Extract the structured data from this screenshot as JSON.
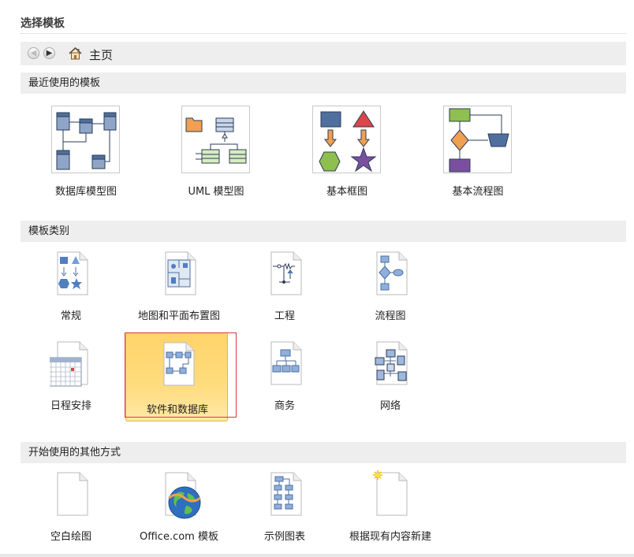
{
  "page": {
    "title": "选择模板"
  },
  "nav": {
    "back_icon": "arrow-left-icon",
    "forward_icon": "arrow-right-icon",
    "home_icon": "home-icon",
    "breadcrumb": "主页"
  },
  "recent": {
    "header": "最近使用的模板",
    "items": [
      {
        "label": "数据库模型图",
        "icon": "database-model-diagram-thumbnail"
      },
      {
        "label": "UML 模型图",
        "icon": "uml-model-diagram-thumbnail"
      },
      {
        "label": "基本框图",
        "icon": "basic-block-diagram-thumbnail"
      },
      {
        "label": "基本流程图",
        "icon": "basic-flowchart-thumbnail"
      }
    ]
  },
  "categories": {
    "header": "模板类别",
    "items": [
      {
        "label": "常规",
        "icon": "general-template-icon"
      },
      {
        "label": "地图和平面布置图",
        "icon": "maps-floor-plans-icon"
      },
      {
        "label": "工程",
        "icon": "engineering-icon"
      },
      {
        "label": "流程图",
        "icon": "flowchart-icon"
      },
      {
        "label": "日程安排",
        "icon": "schedule-icon"
      },
      {
        "label": "软件和数据库",
        "icon": "software-database-icon",
        "selected": true
      },
      {
        "label": "商务",
        "icon": "business-icon"
      },
      {
        "label": "网络",
        "icon": "network-icon"
      }
    ]
  },
  "other": {
    "header": "开始使用的其他方式",
    "items": [
      {
        "label": "空白绘图",
        "icon": "blank-drawing-icon"
      },
      {
        "label": "Office.com 模板",
        "icon": "office-com-globe-icon"
      },
      {
        "label": "示例图表",
        "icon": "sample-diagram-icon"
      },
      {
        "label": "根据现有内容新建",
        "icon": "new-from-existing-icon"
      }
    ]
  },
  "colors": {
    "selection_fill": "#ffd36b",
    "selection_outline": "#d73a3a",
    "section_bg": "#eeeeee",
    "shape_blue": "#4f6f9f",
    "shape_red": "#d9474b",
    "shape_green": "#8fbf4f",
    "shape_purple": "#7b4f9f",
    "shape_orange": "#f0a050"
  }
}
